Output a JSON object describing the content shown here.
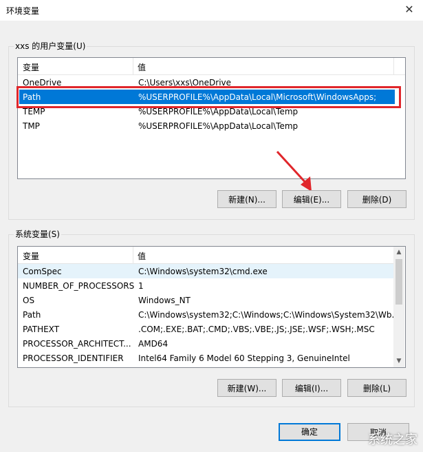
{
  "window": {
    "title": "环境变量",
    "close_glyph": "✕"
  },
  "user_vars": {
    "label": "xxs 的用户变量(U)",
    "columns": [
      "变量",
      "值"
    ],
    "rows": [
      {
        "name": "OneDrive",
        "value": "C:\\Users\\xxs\\OneDrive"
      },
      {
        "name": "Path",
        "value": "%USERPROFILE%\\AppData\\Local\\Microsoft\\WindowsApps;"
      },
      {
        "name": "TEMP",
        "value": "%USERPROFILE%\\AppData\\Local\\Temp"
      },
      {
        "name": "TMP",
        "value": "%USERPROFILE%\\AppData\\Local\\Temp"
      }
    ],
    "buttons": {
      "new": "新建(N)...",
      "edit": "编辑(E)...",
      "delete": "删除(D)"
    }
  },
  "system_vars": {
    "label": "系统变量(S)",
    "columns": [
      "变量",
      "值"
    ],
    "rows": [
      {
        "name": "ComSpec",
        "value": "C:\\Windows\\system32\\cmd.exe"
      },
      {
        "name": "NUMBER_OF_PROCESSORS",
        "value": "1"
      },
      {
        "name": "OS",
        "value": "Windows_NT"
      },
      {
        "name": "Path",
        "value": "C:\\Windows\\system32;C:\\Windows;C:\\Windows\\System32\\Wb..."
      },
      {
        "name": "PATHEXT",
        "value": ".COM;.EXE;.BAT;.CMD;.VBS;.VBE;.JS;.JSE;.WSF;.WSH;.MSC"
      },
      {
        "name": "PROCESSOR_ARCHITECT...",
        "value": "AMD64"
      },
      {
        "name": "PROCESSOR_IDENTIFIER",
        "value": "Intel64 Family 6 Model 60 Stepping 3, GenuineIntel"
      }
    ],
    "buttons": {
      "new": "新建(W)...",
      "edit": "编辑(I)...",
      "delete": "删除(L)"
    }
  },
  "footer": {
    "ok": "确定",
    "cancel": "取消"
  },
  "watermark": "系统之家",
  "colors": {
    "selection": "#0078d7",
    "highlight_box": "#e0262b",
    "arrow": "#e0262b"
  },
  "icons": [
    "close-icon",
    "scroll-up-icon",
    "scroll-down-icon",
    "red-arrow-icon"
  ]
}
